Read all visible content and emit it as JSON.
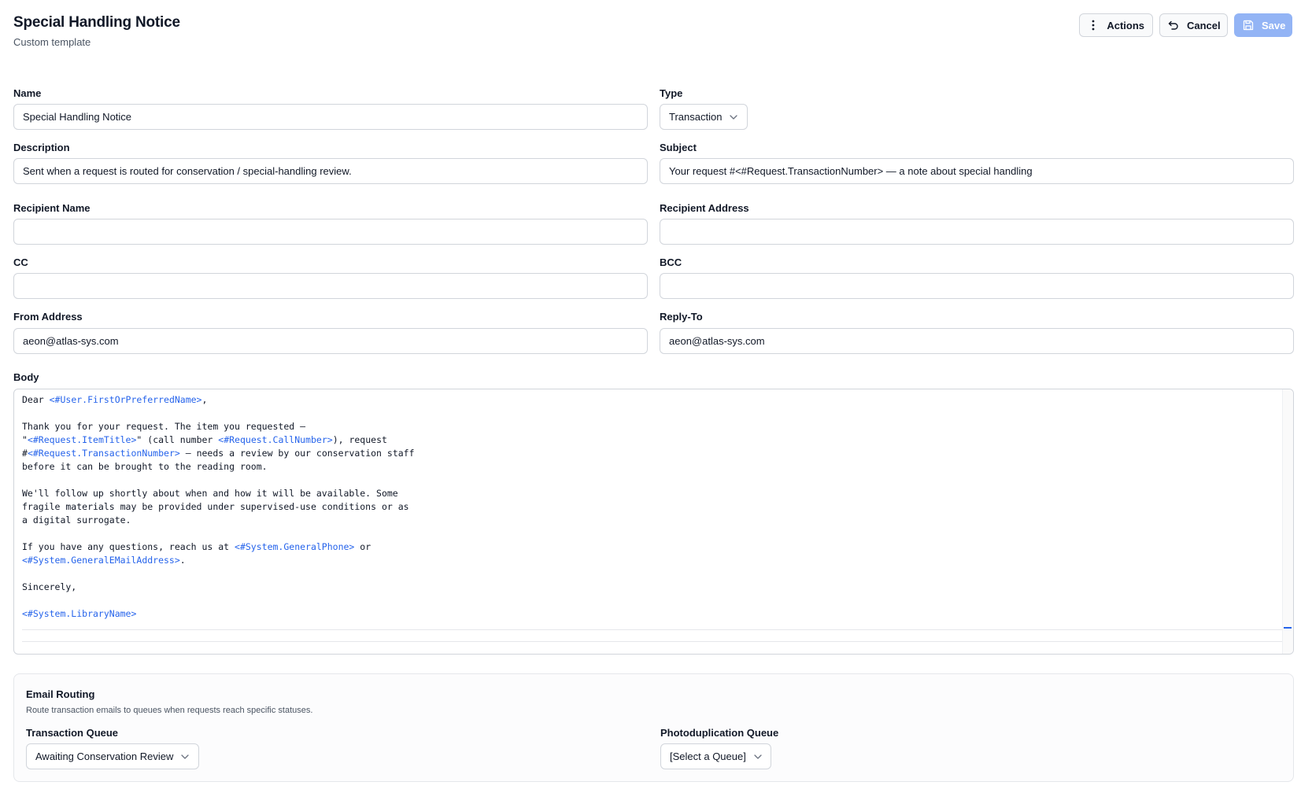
{
  "header": {
    "title": "Special Handling Notice",
    "subtitle": "Custom template"
  },
  "toolbar": {
    "actions_label": "Actions",
    "cancel_label": "Cancel",
    "save_label": "Save"
  },
  "form": {
    "name": {
      "label": "Name",
      "value": "Special Handling Notice"
    },
    "type": {
      "label": "Type",
      "value": "Transaction"
    },
    "description": {
      "label": "Description",
      "value": "Sent when a request is routed for conservation / special-handling review."
    },
    "subject": {
      "label": "Subject",
      "value": "Your request #<#Request.TransactionNumber> — a note about special handling"
    },
    "recipient_name": {
      "label": "Recipient Name",
      "value": ""
    },
    "recipient_address": {
      "label": "Recipient Address",
      "value": ""
    },
    "cc": {
      "label": "CC",
      "value": ""
    },
    "bcc": {
      "label": "BCC",
      "value": ""
    },
    "from_address": {
      "label": "From Address",
      "value": "aeon@atlas-sys.com"
    },
    "reply_to": {
      "label": "Reply-To",
      "value": "aeon@atlas-sys.com"
    }
  },
  "body": {
    "label": "Body",
    "lines": [
      [
        {
          "t": "Dear "
        },
        {
          "t": "<#User.FirstOrPreferredName>",
          "tok": true
        },
        {
          "t": ","
        }
      ],
      [],
      [
        {
          "t": "Thank you for your request. The item you requested —"
        }
      ],
      [
        {
          "t": "\""
        },
        {
          "t": "<#Request.ItemTitle>",
          "tok": true
        },
        {
          "t": "\" (call number "
        },
        {
          "t": "<#Request.CallNumber>",
          "tok": true
        },
        {
          "t": "), request"
        }
      ],
      [
        {
          "t": "#"
        },
        {
          "t": "<#Request.TransactionNumber>",
          "tok": true
        },
        {
          "t": " — needs a review by our conservation staff"
        }
      ],
      [
        {
          "t": "before it can be brought to the reading room."
        }
      ],
      [],
      [
        {
          "t": "We'll follow up shortly about when and how it will be available. Some"
        }
      ],
      [
        {
          "t": "fragile materials may be provided under supervised-use conditions or as"
        }
      ],
      [
        {
          "t": "a digital surrogate."
        }
      ],
      [],
      [
        {
          "t": "If you have any questions, reach us at "
        },
        {
          "t": "<#System.GeneralPhone>",
          "tok": true
        },
        {
          "t": " or"
        }
      ],
      [
        {
          "t": "<#System.GeneralEMailAddress>",
          "tok": true
        },
        {
          "t": "."
        }
      ],
      [],
      [
        {
          "t": "Sincerely,"
        }
      ],
      [],
      [
        {
          "t": "<#System.LibraryName>",
          "tok": true
        }
      ]
    ]
  },
  "routing": {
    "title": "Email Routing",
    "description": "Route transaction emails to queues when requests reach specific statuses.",
    "transaction_queue": {
      "label": "Transaction Queue",
      "value": "Awaiting Conservation Review"
    },
    "photoduplication_queue": {
      "label": "Photoduplication Queue",
      "value": "[Select a Queue]"
    }
  },
  "colors": {
    "accent": "#2563eb",
    "save_button": "#93b4f5"
  },
  "icons": [
    "kebab-menu-icon",
    "undo-icon",
    "save-icon",
    "chevron-down-icon"
  ]
}
